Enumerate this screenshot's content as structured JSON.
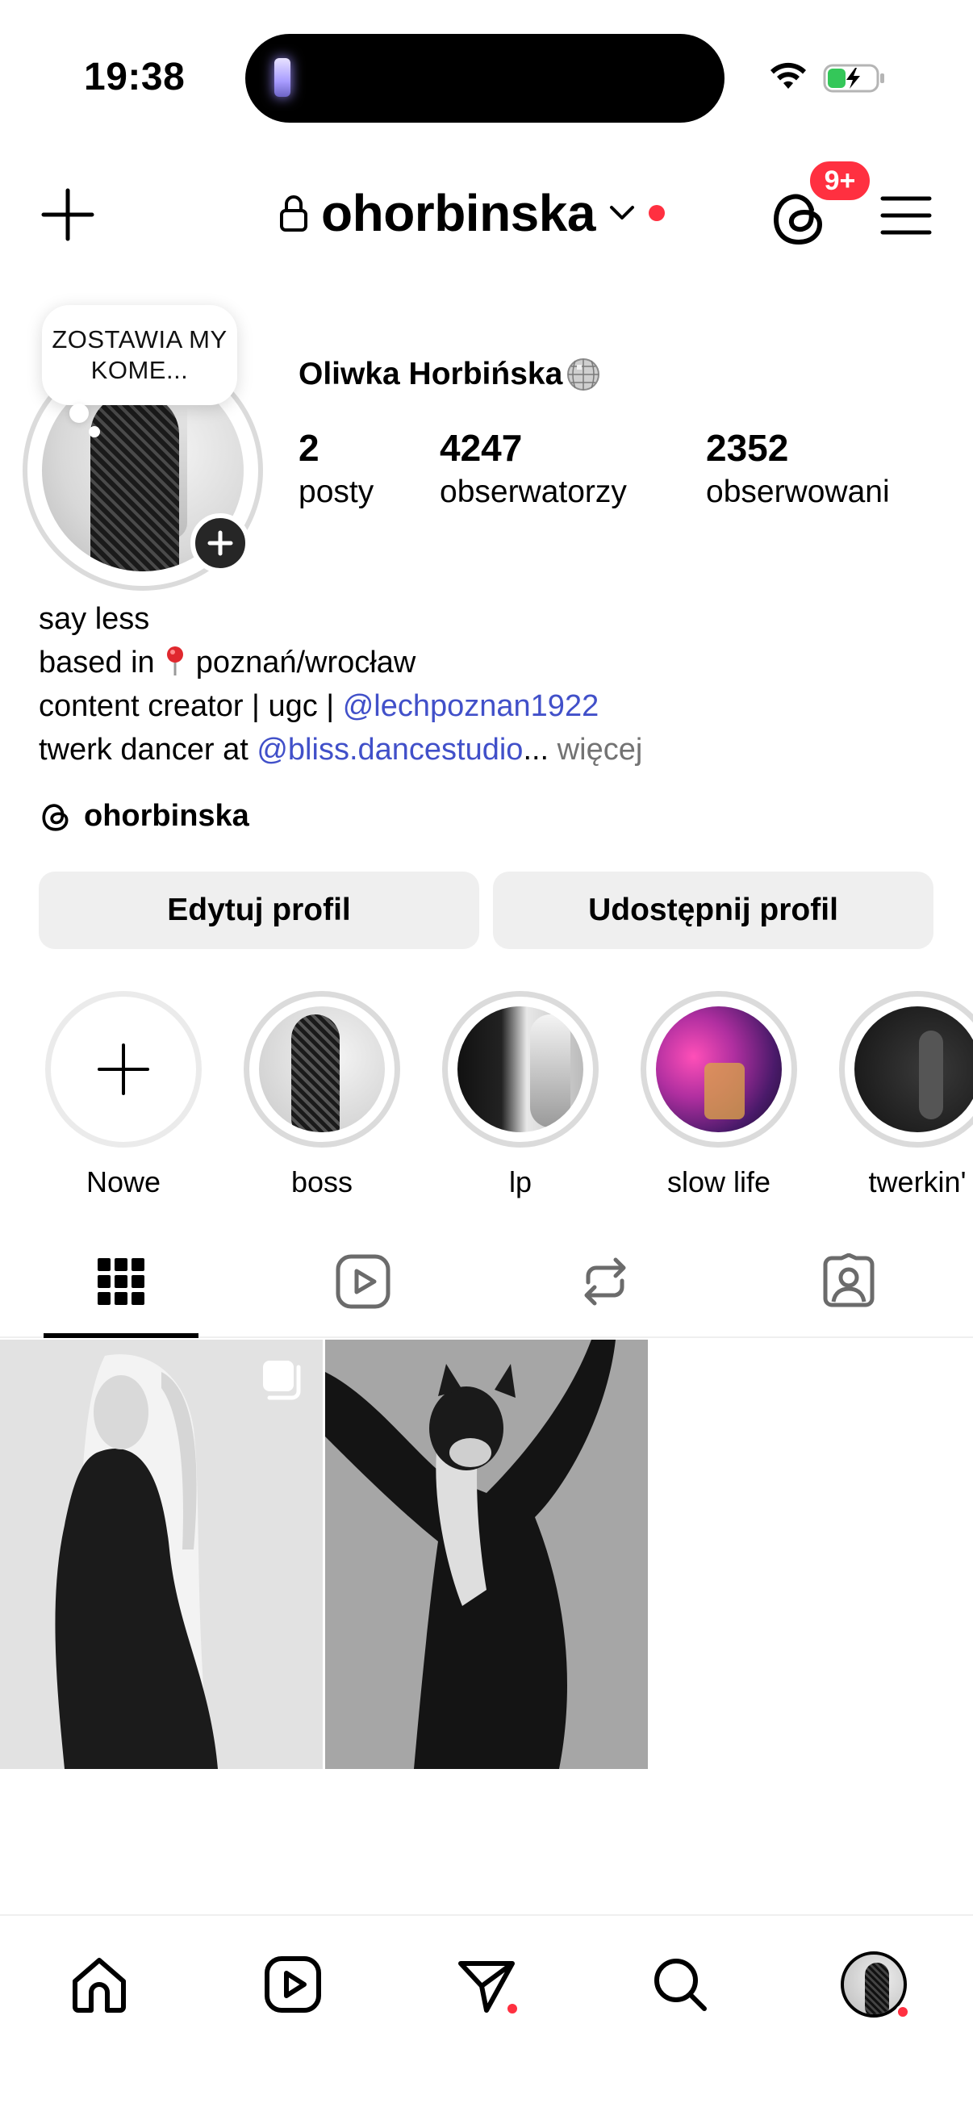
{
  "status_bar": {
    "time": "19:38"
  },
  "header": {
    "username": "ohorbinska",
    "notification_badge": "9+",
    "accent_red": "#ff3040"
  },
  "profile": {
    "note": "ZOSTAWIA MY KOME...",
    "full_name": "Oliwka Horbińska",
    "stats": [
      {
        "value": "2",
        "label": "posty"
      },
      {
        "value": "4247",
        "label": "obserwatorzy"
      },
      {
        "value": "2352",
        "label": "obserwowani"
      }
    ],
    "bio": {
      "line1": "say less",
      "line2": "based in ",
      "line2_place": "poznań/wrocław",
      "line3_prefix": "content creator | ugc | ",
      "line3_mention": "@lechpoznan1922",
      "line4_prefix": "twerk dancer at ",
      "line4_mention": "@bliss.dancestudio",
      "line4_ellipsis": "...",
      "more": " więcej"
    },
    "threads_handle": "ohorbinska",
    "mention_color": "#4150c9"
  },
  "buttons": {
    "edit_profile": "Edytuj profil",
    "share_profile": "Udostępnij profil"
  },
  "highlights": [
    {
      "label": "Nowe"
    },
    {
      "label": "boss"
    },
    {
      "label": "lp"
    },
    {
      "label": "slow life"
    },
    {
      "label": "twerkin'"
    }
  ],
  "tabs": [
    "grid-icon",
    "reels-icon",
    "reposts-icon",
    "tagged-icon"
  ],
  "bottom_nav": [
    "home-icon",
    "reels-icon",
    "direct-icon",
    "search-icon",
    "profile-avatar"
  ]
}
